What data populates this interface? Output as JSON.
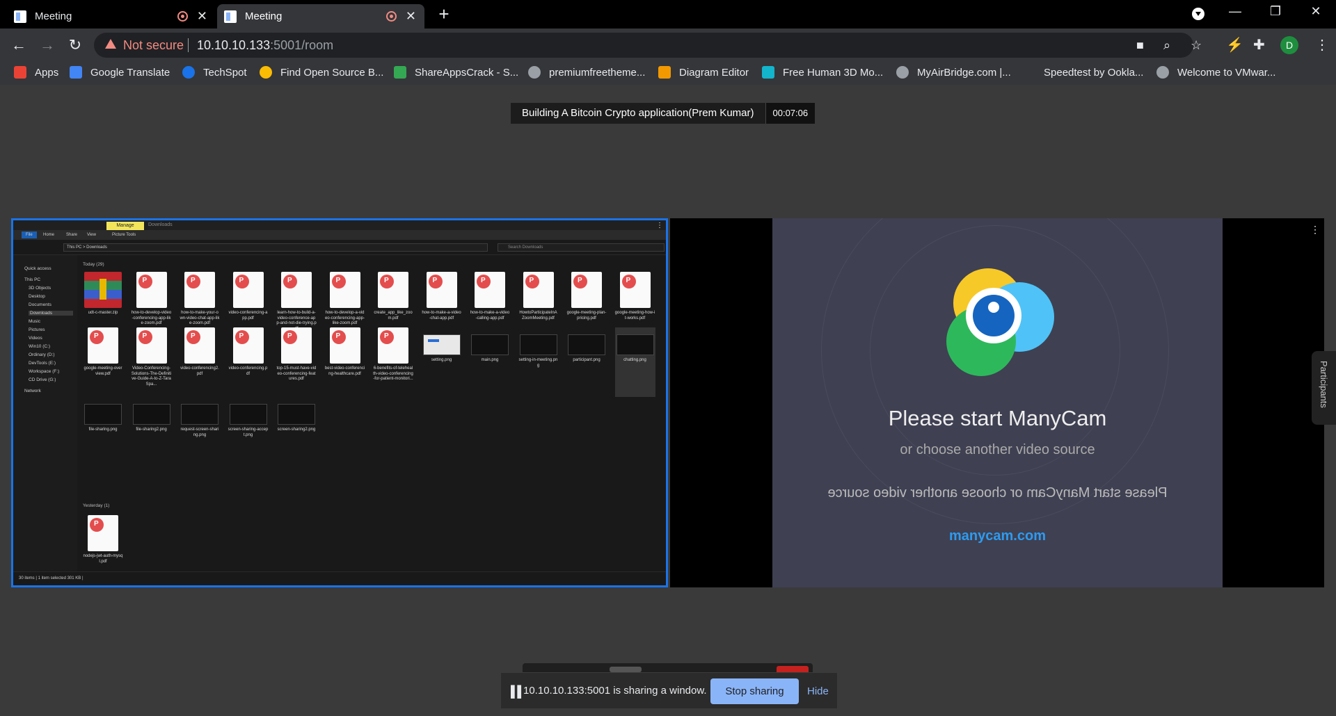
{
  "browser": {
    "tabs": [
      {
        "title": "Meeting"
      },
      {
        "title": "Meeting"
      }
    ],
    "new_tab": "+",
    "omnibox": {
      "security": "Not secure",
      "host": "10.10.10.133",
      "path": ":5001/room"
    },
    "avatar_letter": "D",
    "bookmarks": [
      {
        "label": "Apps",
        "color": "#ea4335"
      },
      {
        "label": "Google Translate",
        "color": "#4285f4"
      },
      {
        "label": "TechSpot",
        "color": "#1a73e8"
      },
      {
        "label": "Find Open Source B...",
        "color": "#fbbc04"
      },
      {
        "label": "ShareAppsCrack - S...",
        "color": "#34a853"
      },
      {
        "label": "premiumfreetheme...",
        "color": "#9aa0a6"
      },
      {
        "label": "Diagram Editor",
        "color": "#f29900"
      },
      {
        "label": "Free Human 3D Mo...",
        "color": "#12b5cb"
      },
      {
        "label": "MyAirBridge.com |...",
        "color": "#9aa0a6"
      },
      {
        "label": "Speedtest by Ookla...",
        "color": "#35363a"
      },
      {
        "label": "Welcome to VMwar...",
        "color": "#9aa0a6"
      }
    ]
  },
  "meeting": {
    "title": "Building A Bitcoin Crypto application(Prem Kumar)",
    "timer": "00:07:06"
  },
  "shared_window": {
    "manage_tab": "Manage",
    "downloads_tab": "Downloads",
    "ribbon": [
      "File",
      "Home",
      "Share",
      "View",
      "Picture Tools"
    ],
    "address": "This PC  >  Downloads",
    "search_placeholder": "Search Downloads",
    "nav": [
      "Quick access",
      "This PC",
      "3D Objects",
      "Desktop",
      "Documents",
      "Downloads",
      "Music",
      "Pictures",
      "Videos",
      "Win10 (C:)",
      "Ordinary (D:)",
      "DevTools (E:)",
      "Workspace (F:)",
      "CD Drive (G:)",
      "Network"
    ],
    "group_today": "Today (29)",
    "group_yesterday": "Yesterday (1)",
    "files_row1": [
      {
        "name": "udt-c-master.zip",
        "kind": "zip"
      },
      {
        "name": "how-to-develop-video-conferencing-app-like-zoom.pdf",
        "kind": "pdf"
      },
      {
        "name": "how-to-make-your-own-video-chat-app-like-zoom.pdf",
        "kind": "pdf"
      },
      {
        "name": "video-conferencing-app.pdf",
        "kind": "pdf"
      },
      {
        "name": "learn-how-to-build-a-video-conference-app-and-not-die-trying.pdf",
        "kind": "pdf"
      },
      {
        "name": "how-to-develop-a-video-conferencing-app-like-zoom.pdf",
        "kind": "pdf"
      },
      {
        "name": "create_app_like_zoom.pdf",
        "kind": "pdf"
      },
      {
        "name": "how-to-make-a-video-chat-app.pdf",
        "kind": "pdf"
      },
      {
        "name": "how-to-make-a-video-calling-app.pdf",
        "kind": "pdf"
      },
      {
        "name": "HowtoParticipateInAZoomMeeting.pdf",
        "kind": "pdf"
      },
      {
        "name": "google-meeting-plan-pricing.pdf",
        "kind": "pdf"
      },
      {
        "name": "google-meeting-how-it-works.pdf",
        "kind": "pdf"
      }
    ],
    "files_row2": [
      {
        "name": "google-meeting-overview.pdf",
        "kind": "pdf"
      },
      {
        "name": "Video-Conferencing-Solutions-The-Definitive-Guide-A-to-Z-TaraSpa...",
        "kind": "pdf"
      },
      {
        "name": "video-conferencing2.pdf",
        "kind": "pdf"
      },
      {
        "name": "video-conferencing.pdf",
        "kind": "pdf"
      },
      {
        "name": "top-15-must-have-video-conferencing-features.pdf",
        "kind": "pdf"
      },
      {
        "name": "best-video-conferencing-healthcare.pdf",
        "kind": "pdf"
      },
      {
        "name": "6-benefits-of-telehealth-video-conferencing-for-patient-monitori...",
        "kind": "pdf"
      },
      {
        "name": "setting.png",
        "kind": "img-light"
      },
      {
        "name": "main.png",
        "kind": "img"
      },
      {
        "name": "setting-in-meeting.png",
        "kind": "img"
      },
      {
        "name": "participant.png",
        "kind": "img"
      },
      {
        "name": "chatting.png",
        "kind": "img"
      }
    ],
    "files_row3": [
      {
        "name": "file-sharing.png",
        "kind": "img"
      },
      {
        "name": "file-sharing2.png",
        "kind": "img"
      },
      {
        "name": "request-screen-sharing.png",
        "kind": "img"
      },
      {
        "name": "screen-sharing-accept.png",
        "kind": "img"
      },
      {
        "name": "screen-sharing2.png",
        "kind": "img"
      }
    ],
    "files_yesterday": [
      {
        "name": "nodejs-jwt-auth-mysql.pdf",
        "kind": "pdf"
      }
    ],
    "status": "30 items   |   1 item selected  301 KB   |"
  },
  "manycam": {
    "title": "Please start ManyCam",
    "subtitle": "or choose another video source",
    "mirrored": "Please start ManyCam or choose another video source",
    "link": "manycam.com"
  },
  "participants_label": "Participants",
  "share_notice": {
    "message": "10.10.10.133:5001 is sharing a window.",
    "stop_label": "Stop sharing",
    "hide_label": "Hide"
  }
}
